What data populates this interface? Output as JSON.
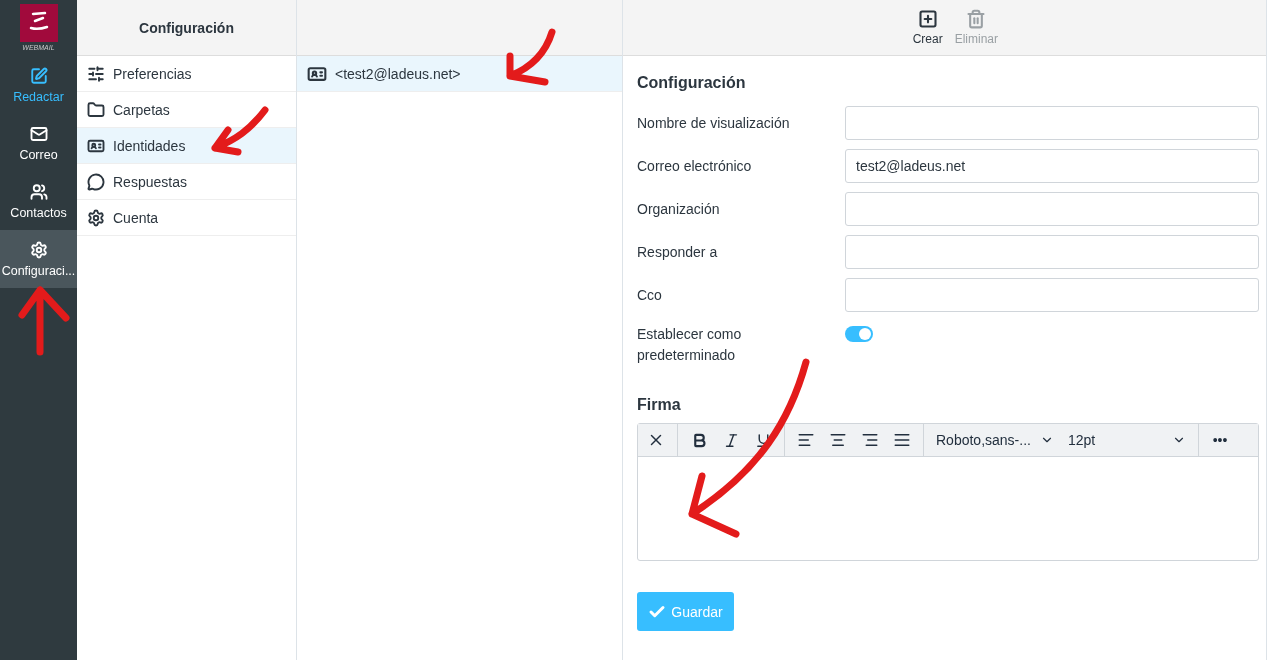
{
  "logo": {
    "caption": "WEBMAIL"
  },
  "nav": [
    {
      "kind": "compose",
      "label": "Redactar",
      "selected": false,
      "highlight": true
    },
    {
      "kind": "mail",
      "label": "Correo",
      "selected": false,
      "highlight": false
    },
    {
      "kind": "contacts",
      "label": "Contactos",
      "selected": false,
      "highlight": false
    },
    {
      "kind": "settings",
      "label": "Configuraci...",
      "selected": true,
      "highlight": false
    }
  ],
  "settings_panel": {
    "title": "Configuración",
    "items": [
      {
        "kind": "sliders",
        "label": "Preferencias",
        "selected": false
      },
      {
        "kind": "folder",
        "label": "Carpetas",
        "selected": false
      },
      {
        "kind": "idcard",
        "label": "Identidades",
        "selected": true
      },
      {
        "kind": "comment",
        "label": "Respuestas",
        "selected": false
      },
      {
        "kind": "gear",
        "label": "Cuenta",
        "selected": false
      }
    ]
  },
  "identities": [
    {
      "label": "<test2@ladeus.net>",
      "selected": true
    }
  ],
  "toolbar": [
    {
      "kind": "create",
      "label": "Crear",
      "disabled": false
    },
    {
      "kind": "delete",
      "label": "Eliminar",
      "disabled": true
    }
  ],
  "form": {
    "title": "Configuración",
    "fields": [
      {
        "label": "Nombre de visualización"
      },
      {
        "label": "Correo electrónico",
        "value": "test2@ladeus.net"
      },
      {
        "label": "Organización"
      },
      {
        "label": "Responder a"
      },
      {
        "label": "Cco"
      }
    ],
    "default_toggle": {
      "label": "Establecer como predeterminado",
      "on": true
    },
    "signature": {
      "title": "Firma",
      "font": "Roboto,sans-...",
      "size": "12pt",
      "more": "•••"
    },
    "save_button": "Guardar"
  },
  "annotation_arrows": [
    {
      "kind": "to-identity"
    },
    {
      "kind": "to-sidebar"
    },
    {
      "kind": "to-list"
    },
    {
      "kind": "to-signature"
    }
  ]
}
